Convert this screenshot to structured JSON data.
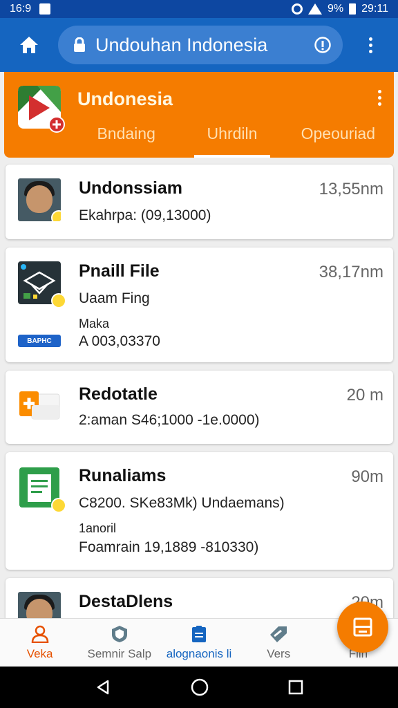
{
  "status_bar": {
    "time_left": "16:9",
    "battery_text": "9%",
    "time_right": "29:11"
  },
  "browser": {
    "url": "Undouhan Indonesia"
  },
  "app": {
    "title": "Undonesia",
    "tabs": [
      {
        "label": "Bndaing",
        "active": false
      },
      {
        "label": "Uhrdiln",
        "active": true
      },
      {
        "label": "Opeouriad",
        "active": false
      }
    ]
  },
  "files": [
    {
      "name": "Undonssiam",
      "size": "13,55nm",
      "lines": [
        "Ekahrpa: (09,13000)"
      ]
    },
    {
      "name": "Pnaill File",
      "size": "38,17nm",
      "lines": [
        "Uaam Fing",
        "Maka",
        "A 003,03370"
      ],
      "chip": "BAPHC"
    },
    {
      "name": "Redotatle",
      "size": "20 m",
      "lines": [
        "2:aman S46;1000 -1e.0000)"
      ]
    },
    {
      "name": "Runaliams",
      "size": "90m",
      "lines": [
        "C8200. SKe83Mk)  Undaemans)",
        "1anoril",
        "Foamrain 19,1889 -810330)"
      ]
    },
    {
      "name": "DestaDlens",
      "size": "20m",
      "lines": []
    }
  ],
  "bottom_nav": [
    {
      "label": "Veka",
      "icon": "person-icon"
    },
    {
      "label": "Semnir Salp",
      "icon": "shield-icon"
    },
    {
      "label": "alognaonis li",
      "icon": "document-icon"
    },
    {
      "label": "Vers",
      "icon": "tag-icon"
    },
    {
      "label": "Filn",
      "icon": "list-icon"
    }
  ],
  "colors": {
    "status_bar": "#0d47a1",
    "toolbar": "#1565c0",
    "accent": "#f57c00",
    "active_nav": "#e65100"
  }
}
